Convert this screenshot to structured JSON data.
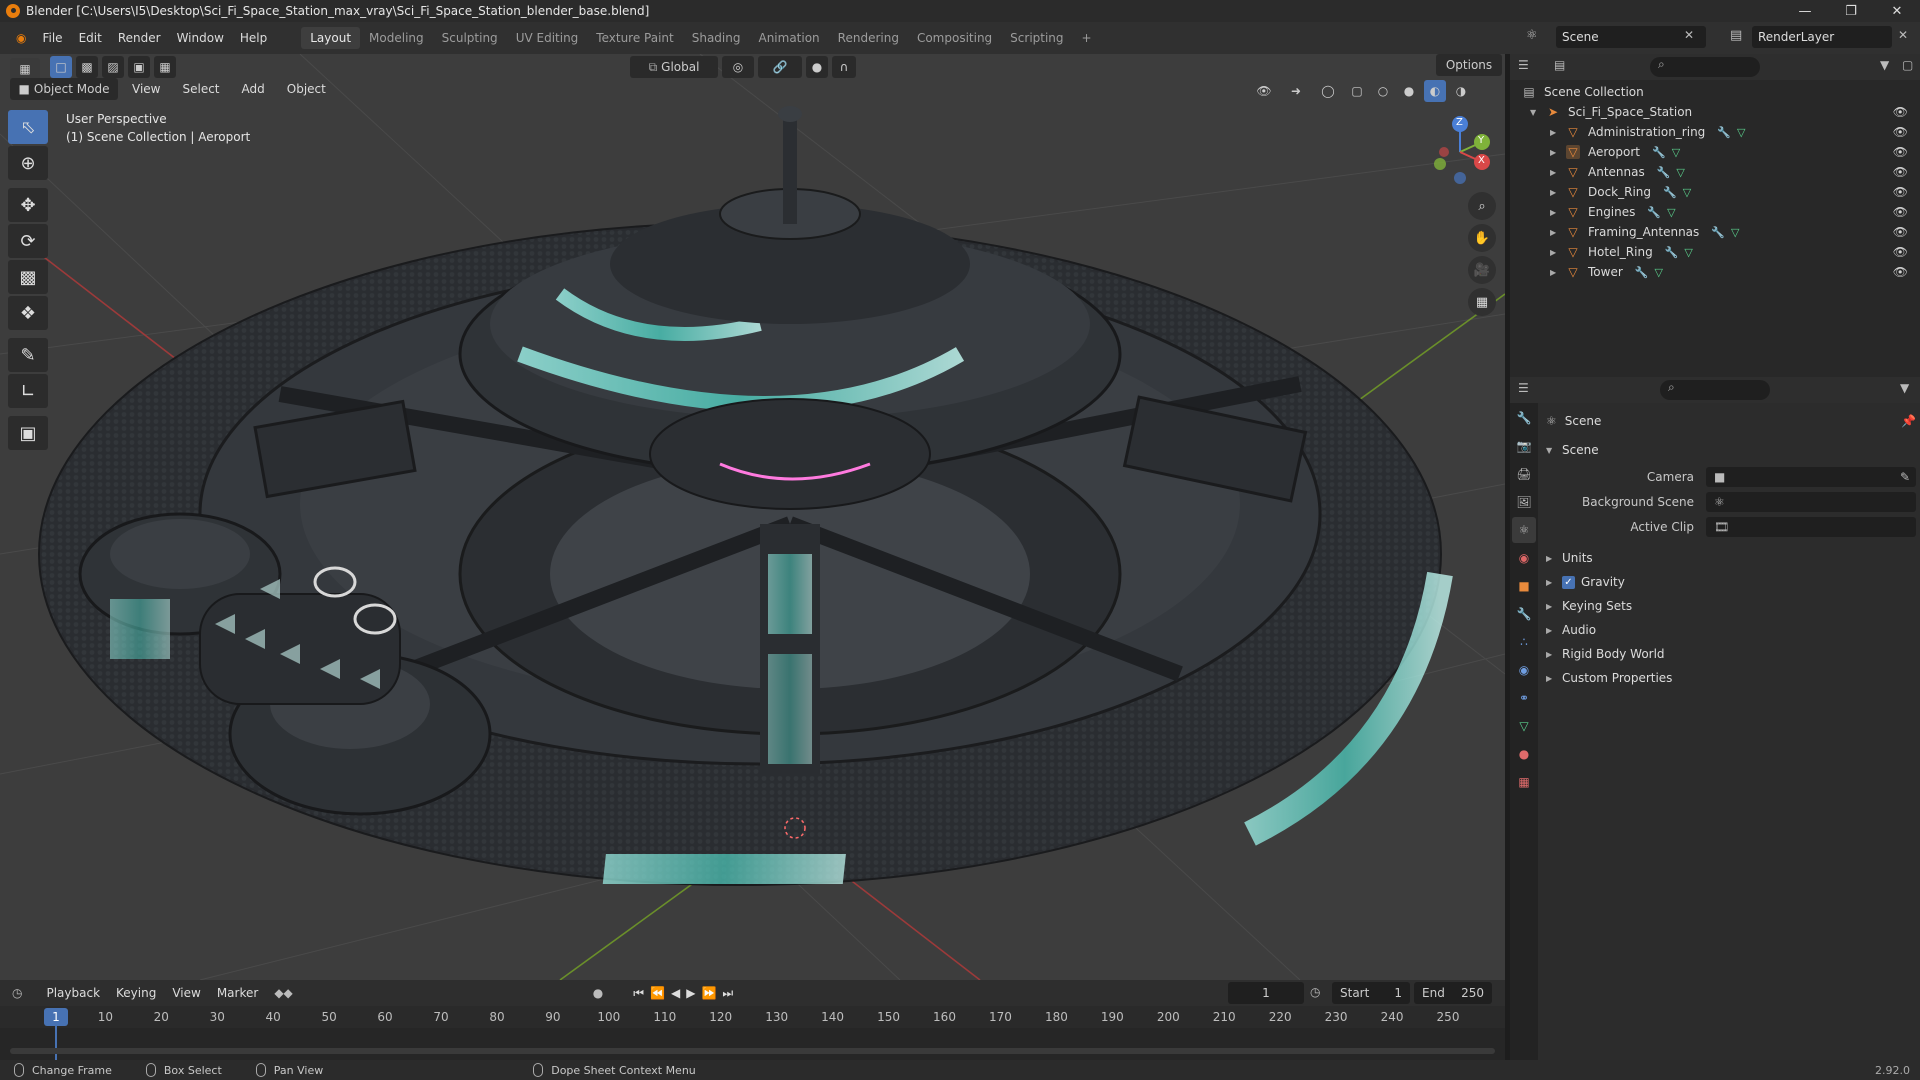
{
  "window": {
    "title": "Blender [C:\\Users\\I5\\Desktop\\Sci_Fi_Space_Station_max_vray\\Sci_Fi_Space_Station_blender_base.blend]",
    "controls": [
      "—",
      "❐",
      "✕"
    ]
  },
  "menubar": {
    "menus": [
      "File",
      "Edit",
      "Render",
      "Window",
      "Help"
    ],
    "workspaces": [
      "Layout",
      "Modeling",
      "Sculpting",
      "UV Editing",
      "Texture Paint",
      "Shading",
      "Animation",
      "Rendering",
      "Compositing",
      "Scripting"
    ],
    "active_workspace": "Layout",
    "add_tab": "+",
    "scene_name": "Scene",
    "render_layer": "RenderLayer"
  },
  "viewport": {
    "mode": "Object Mode",
    "menus": [
      "View",
      "Select",
      "Add",
      "Object"
    ],
    "orientation": "Global",
    "options_label": "Options",
    "perspective_label": "User Perspective",
    "context_label": "(1) Scene Collection | Aeroport",
    "axes": {
      "x": "X",
      "y": "Y",
      "z": "Z"
    },
    "tools": [
      "select-box",
      "cursor",
      "move",
      "rotate",
      "scale",
      "transform",
      "annotate",
      "measure",
      "add-cube"
    ]
  },
  "outliner": {
    "root": "Scene Collection",
    "collection": "Sci_Fi_Space_Station",
    "items": [
      {
        "name": "Administration_ring"
      },
      {
        "name": "Aeroport"
      },
      {
        "name": "Antennas"
      },
      {
        "name": "Dock_Ring"
      },
      {
        "name": "Engines"
      },
      {
        "name": "Framing_Antennas"
      },
      {
        "name": "Hotel_Ring"
      },
      {
        "name": "Tower"
      }
    ]
  },
  "properties": {
    "context": "Scene",
    "section": "Scene",
    "fields": [
      {
        "label": "Camera",
        "value": ""
      },
      {
        "label": "Background Scene",
        "value": ""
      },
      {
        "label": "Active Clip",
        "value": ""
      }
    ],
    "panels": [
      "Units",
      "Gravity",
      "Keying Sets",
      "Audio",
      "Rigid Body World",
      "Custom Properties"
    ],
    "gravity_checked": true
  },
  "timeline": {
    "menus": [
      "Playback",
      "Keying",
      "View",
      "Marker"
    ],
    "current_frame": "1",
    "start_label": "Start",
    "start_value": "1",
    "end_label": "End",
    "end_value": "250",
    "ticks": [
      "10",
      "20",
      "30",
      "40",
      "50",
      "60",
      "70",
      "80",
      "90",
      "100",
      "110",
      "120",
      "130",
      "140",
      "150",
      "160",
      "170",
      "180",
      "190",
      "200",
      "210",
      "220",
      "230",
      "240",
      "250"
    ],
    "playhead_label": "1"
  },
  "statusbar": {
    "items": [
      "Change Frame",
      "Box Select",
      "Pan View",
      "Dope Sheet Context Menu"
    ],
    "version": "2.92.0"
  },
  "colors": {
    "accent": "#4772b3",
    "brand": "#e87d0d",
    "grid_red": "#9c3a3a",
    "grid_green": "#6a8f2a",
    "window_glow": "#5fd6c8"
  }
}
